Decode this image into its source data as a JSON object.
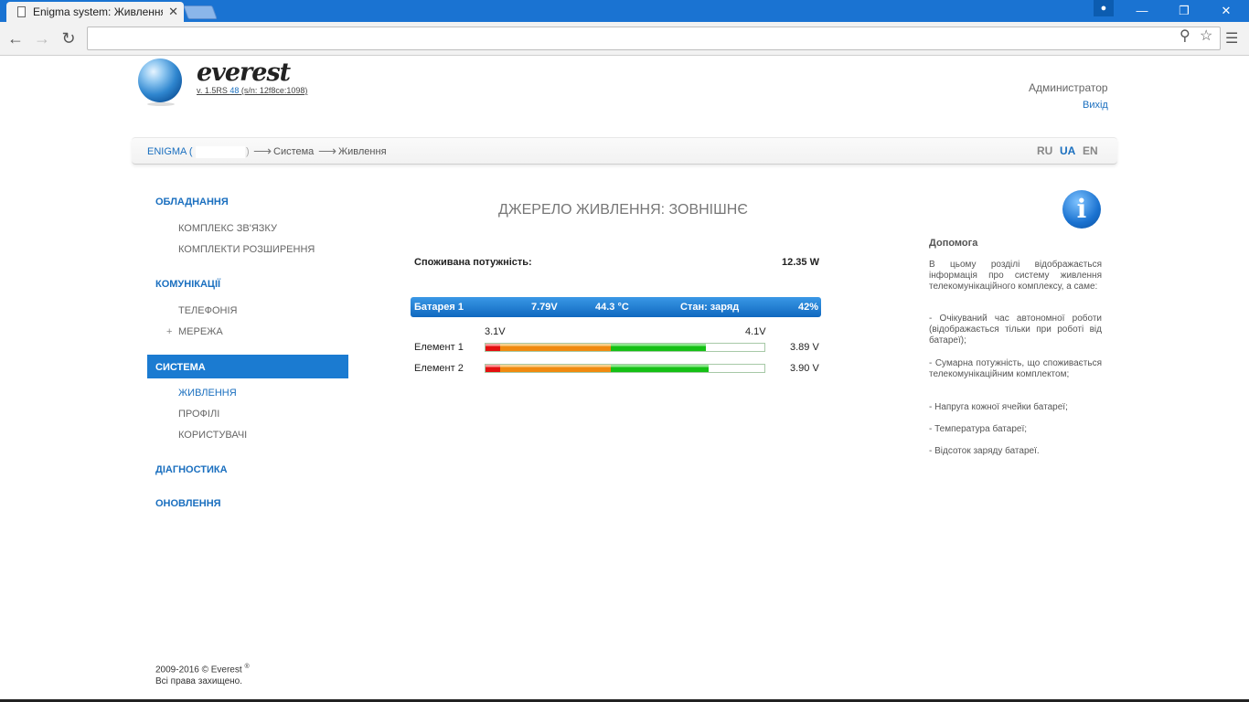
{
  "browser": {
    "tab_title": "Enigma system: Живлення",
    "address": "",
    "win_minimize": "—",
    "win_restore": "❐",
    "win_close": "✕"
  },
  "header": {
    "brand": "everest",
    "version_prefix": "v. 1.5RS ",
    "version_num": "48",
    "version_suffix": " (s/n: 12f8ce:1098)",
    "user": "Администратор",
    "logout": "Вихід"
  },
  "breadcrumb": {
    "home": "ENIGMA (",
    "home_close": ")",
    "arrow": "⟶",
    "section": "Система",
    "page": "Живлення"
  },
  "languages": [
    "RU",
    "UA",
    "EN"
  ],
  "active_language": "UA",
  "sidebar": {
    "group1": "ОБЛАДНАННЯ",
    "group1_items": [
      "КОМПЛЕКС ЗВ'ЯЗКУ",
      "КОМПЛЕКТИ РОЗШИРЕННЯ"
    ],
    "group2": "КОМУНІКАЦІЇ",
    "group2_items": [
      "ТЕЛЕФОНІЯ",
      "МЕРЕЖА"
    ],
    "group3": "СИСТЕМА",
    "group3_items": [
      "ЖИВЛЕННЯ",
      "ПРОФІЛІ",
      "КОРИСТУВАЧІ"
    ],
    "group4": "ДІАГНОСТИКА",
    "group5": "ОНОВЛЕННЯ"
  },
  "main": {
    "title": "ДЖЕРЕЛО ЖИВЛЕННЯ: ЗОВНІШНЄ",
    "consumed_label": "Споживана потужність:",
    "consumed_value": "12.35 W",
    "battery": {
      "name": "Батарея 1",
      "voltage": "7.79V",
      "temp": "44.3 °C",
      "state": "Стан: заряд",
      "percent": "42%"
    },
    "scale_min": "3.1V",
    "scale_max": "4.1V",
    "cells": [
      {
        "label": "Елемент 1",
        "value": "3.89 V",
        "level": 0.79
      },
      {
        "label": "Елемент 2",
        "value": "3.90 V",
        "level": 0.8
      }
    ]
  },
  "help": {
    "icon": "i",
    "title": "Допомога",
    "p1": "В цьому розділі відображається інформація про систему живлення телекомунікаційного комплексу, а саме:",
    "p2": "- Очікуваний час автономної роботи (відображається тільки при роботі від батареї);",
    "p3": "- Сумарна потужність, що споживається телекомунікаційним комплектом;",
    "p4": "- Напруга кожної ячейки батареї;",
    "p5": "- Температура батареї;",
    "p6": "- Відсоток заряду батареї."
  },
  "footer": {
    "line1": "2009-2016 © Everest",
    "reg": "®",
    "line2": "Всі права захищено."
  }
}
